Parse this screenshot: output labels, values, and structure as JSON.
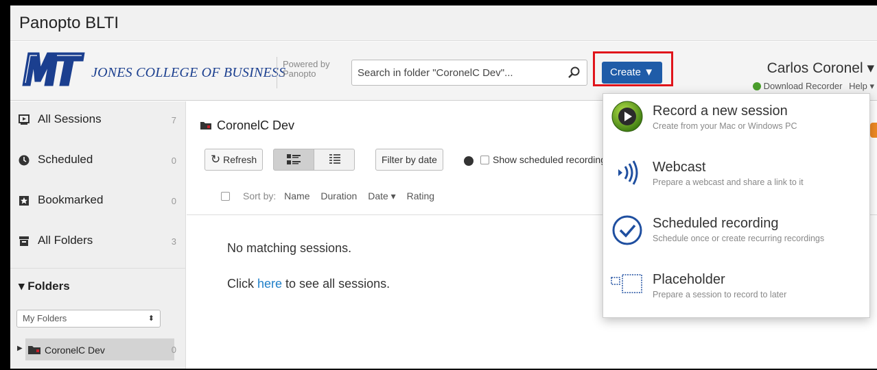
{
  "window": {
    "title": "Panopto BLTI"
  },
  "header": {
    "brand_text": "JONES COLLEGE OF BUSINESS",
    "powered_by": "Powered by",
    "powered_name": "Panopto",
    "search_placeholder": "Search in folder \"CoronelC Dev\"...",
    "create_label": "Create ▼",
    "user_name": "Carlos Coronel ▾",
    "download_recorder": "Download Recorder",
    "help": "Help ▾",
    "accent_color": "#1f5ca8",
    "highlight_color": "#e0141b"
  },
  "sidebar": {
    "items": [
      {
        "label": "All Sessions",
        "count": "7",
        "icon": "play-square-icon"
      },
      {
        "label": "Scheduled",
        "count": "0",
        "icon": "clock-icon"
      },
      {
        "label": "Bookmarked",
        "count": "0",
        "icon": "bookmark-icon"
      },
      {
        "label": "All Folders",
        "count": "3",
        "icon": "archive-icon"
      }
    ],
    "folders_heading": "▾ Folders",
    "folder_select": "My Folders",
    "tree": [
      {
        "label": "CoronelC Dev",
        "count": "0"
      }
    ]
  },
  "main": {
    "folder_title": "CoronelC Dev",
    "toolbar": {
      "refresh": "Refresh",
      "filter_by_date": "Filter by date",
      "show_scheduled": "Show scheduled recordings"
    },
    "sort": {
      "sort_by": "Sort by:",
      "name": "Name",
      "duration": "Duration",
      "date": "Date ▾",
      "rating": "Rating"
    },
    "empty_message": "No matching sessions.",
    "click_prefix": "Click ",
    "click_link": "here",
    "click_suffix": " to see all sessions."
  },
  "create_menu": {
    "items": [
      {
        "title": "Record a new session",
        "subtitle": "Create from your Mac or Windows PC",
        "icon": "record-play-icon"
      },
      {
        "title": "Webcast",
        "subtitle": "Prepare a webcast and share a link to it",
        "icon": "webcast-icon"
      },
      {
        "title": "Scheduled recording",
        "subtitle": "Schedule once or create recurring recordings",
        "icon": "scheduled-check-icon"
      },
      {
        "title": "Placeholder",
        "subtitle": "Prepare a session to record to later",
        "icon": "placeholder-icon"
      }
    ]
  }
}
